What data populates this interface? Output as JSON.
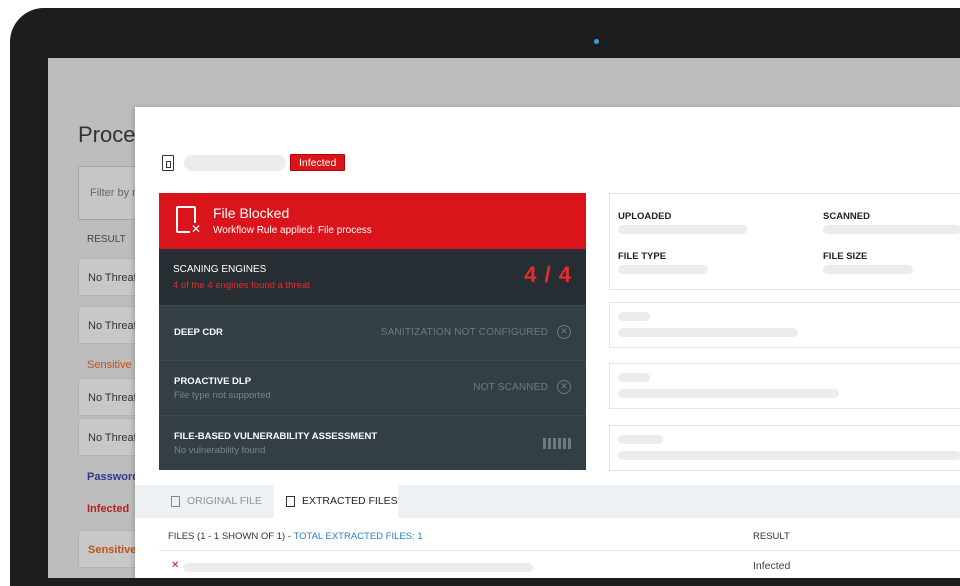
{
  "background_page": {
    "title": "Proce",
    "filter_placeholder": "Filter by n",
    "result_header": "RESULT",
    "rows": [
      {
        "text": "No Threat",
        "color": "#333333"
      },
      {
        "text": "No Threat",
        "color": "#333333"
      },
      {
        "text": "Sensitive",
        "color": "#c0501f"
      },
      {
        "text": "No Threat",
        "color": "#333333"
      },
      {
        "text": "No Threat",
        "color": "#333333"
      },
      {
        "text": "Password",
        "color": "#2b3a8c"
      },
      {
        "text": "Infected",
        "color": "#b5211d"
      },
      {
        "text": "Sensitive",
        "color": "#c0501f"
      }
    ]
  },
  "modal": {
    "status_badge": "Infected",
    "blocked": {
      "title": "File Blocked",
      "subtitle": "Workflow Rule applied: File process"
    },
    "engines": {
      "label": "SCANING ENGINES",
      "summary": "4 of the 4 engines found a threat",
      "count": "4 / 4"
    },
    "features": [
      {
        "name": "DEEP CDR",
        "sub": "",
        "status": "SANITIZATION NOT CONFIGURED",
        "icon": "circle-x-icon"
      },
      {
        "name": "PROACTIVE DLP",
        "sub": "File type not supported",
        "status": "NOT SCANNED",
        "icon": "circle-x-icon"
      },
      {
        "name": "FILE-BASED VULNERABILITY ASSESSMENT",
        "sub": "No vulnerability found",
        "status": "",
        "icon": "bars-icon"
      }
    ],
    "meta": {
      "uploaded_label": "UPLOADED",
      "scanned_label": "SCANNED",
      "file_type_label": "FILE TYPE",
      "file_size_label": "FILE SIZE"
    },
    "tabs": {
      "original": "ORIGINAL FILE",
      "extracted": "EXTRACTED FILES"
    },
    "files_table": {
      "header_prefix": "FILES (1 - 1 SHOWN OF 1) - ",
      "header_total": "TOTAL EXTRACTED FILES: 1",
      "result_header": "RESULT",
      "rows": [
        {
          "result": "Infected"
        }
      ]
    }
  },
  "colors": {
    "accent_red": "#d9141b",
    "panel_dark": "#2f3b41",
    "link_blue": "#2a7fc4"
  }
}
